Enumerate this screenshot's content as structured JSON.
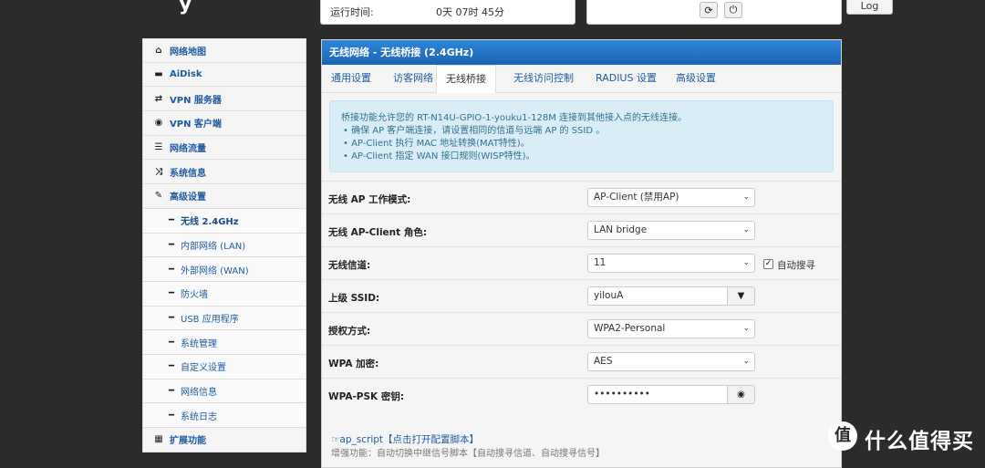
{
  "header": {
    "uptime_label": "运行时间:",
    "uptime_value": "0天 07时 45分",
    "log_button": "Log"
  },
  "sidebar": {
    "items": [
      {
        "label": "网络地图",
        "icon": "home-icon",
        "glyph": "⌂",
        "type": "top"
      },
      {
        "label": "AiDisk",
        "icon": "disk-icon",
        "glyph": "▬",
        "type": "top"
      },
      {
        "label": "VPN 服务器",
        "icon": "retweet-icon",
        "glyph": "⇄",
        "type": "top"
      },
      {
        "label": "VPN 客户端",
        "icon": "globe-icon",
        "glyph": "◉",
        "type": "top"
      },
      {
        "label": "网络流量",
        "icon": "list-icon",
        "glyph": "☰",
        "type": "top"
      },
      {
        "label": "系统信息",
        "icon": "random-icon",
        "glyph": "⤨",
        "type": "top"
      },
      {
        "label": "高级设置",
        "icon": "wrench-icon",
        "glyph": "✎",
        "type": "top"
      },
      {
        "label": "无线 2.4GHz",
        "icon": "dash-icon",
        "glyph": "━",
        "type": "sub",
        "active": true
      },
      {
        "label": "内部网络 (LAN)",
        "icon": "dash-icon",
        "glyph": "━",
        "type": "sub"
      },
      {
        "label": "外部网络 (WAN)",
        "icon": "dash-icon",
        "glyph": "━",
        "type": "sub"
      },
      {
        "label": "防火墙",
        "icon": "dash-icon",
        "glyph": "━",
        "type": "sub"
      },
      {
        "label": "USB 应用程序",
        "icon": "dash-icon",
        "glyph": "━",
        "type": "sub"
      },
      {
        "label": "系统管理",
        "icon": "dash-icon",
        "glyph": "━",
        "type": "sub"
      },
      {
        "label": "自定义设置",
        "icon": "dash-icon",
        "glyph": "━",
        "type": "sub"
      },
      {
        "label": "网络信息",
        "icon": "dash-icon",
        "glyph": "━",
        "type": "sub"
      },
      {
        "label": "系统日志",
        "icon": "dash-icon",
        "glyph": "━",
        "type": "sub"
      },
      {
        "label": "扩展功能",
        "icon": "grid-icon",
        "glyph": "▦",
        "type": "top"
      }
    ]
  },
  "panel": {
    "title": "无线网络 - 无线桥接 (2.4GHz)",
    "tabs": [
      "通用设置",
      "访客网络",
      "无线桥接",
      "无线访问控制",
      "RADIUS 设置",
      "高级设置"
    ],
    "active_tab": "无线桥接",
    "info_lines": [
      "桥接功能允许您的 RT-N14U-GPIO-1-youku1-128M 连接到其他接入点的无线连接。",
      "•  确保 AP 客户端连接，请设置相同的信道与远端 AP 的 SSID 。",
      "•  AP-Client 执行 MAC 地址转换(MAT特性)。",
      "•  AP-Client 指定 WAN 接口规则(WISP特性)。"
    ],
    "fields": {
      "ap_mode_label": "无线 AP 工作模式:",
      "ap_mode_value": "AP-Client (禁用AP)",
      "role_label": "无线 AP-Client 角色:",
      "role_value": "LAN bridge",
      "channel_label": "无线信道:",
      "channel_value": "11",
      "auto_search_label": "自动搜寻",
      "ssid_label": "上级 SSID:",
      "ssid_value": "yilouA",
      "auth_label": "授权方式:",
      "auth_value": "WPA2-Personal",
      "wpa_enc_label": "WPA 加密:",
      "wpa_enc_value": "AES",
      "psk_label": "WPA-PSK 密钥:",
      "psk_value": "••••••••••"
    },
    "script_link": "ap_script【点击打开配置脚本】",
    "script_note": "增强功能：自动切换中继信号脚本【自动搜寻信道、自动搜寻信号】"
  },
  "watermark": {
    "logo_char": "值",
    "text": "什么值得买"
  },
  "colors": {
    "panel_header": "#1b64b5",
    "link": "#1f5a9e",
    "info_bg": "#d9edf7",
    "page_bg": "#2b2b2b"
  }
}
